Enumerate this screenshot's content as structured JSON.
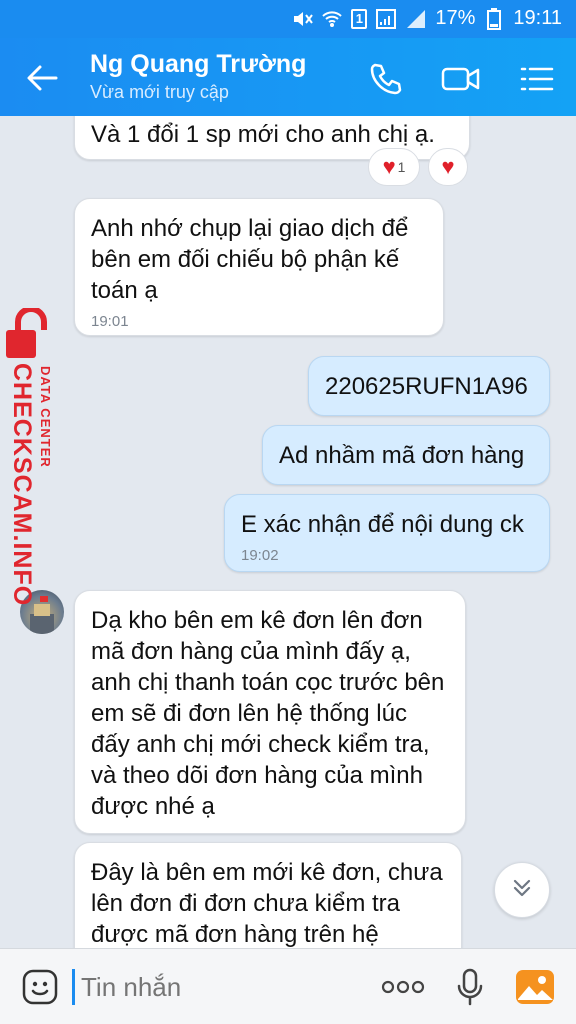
{
  "status_bar": {
    "sim": "1",
    "battery": "17%",
    "time": "19:11"
  },
  "header": {
    "title": "Ng Quang Trường",
    "subtitle": "Vừa mới truy cập",
    "icons": [
      "back-arrow-icon",
      "phone-icon",
      "video-call-icon",
      "menu-list-icon"
    ]
  },
  "messages": [
    {
      "side": "in",
      "text": "Và 1 đổi 1 sp mới cho anh chị ạ."
    },
    {
      "side": "in",
      "text": "Anh nhớ chụp lại giao dịch để bên em đối chiếu bộ phận kế toán ạ",
      "time": "19:01"
    },
    {
      "side": "out",
      "text": "220625RUFN1A96"
    },
    {
      "side": "out",
      "text": "Ad nhầm mã đơn hàng"
    },
    {
      "side": "out",
      "text": "E xác nhận để nội dung ck",
      "time": "19:02"
    },
    {
      "side": "in",
      "text": "Dạ kho bên em kê đơn lên đơn mã đơn hàng của mình đấy ạ, anh chị thanh toán cọc trước bên em sẽ đi đơn lên hệ thống lúc đấy anh chị mới check kiểm tra, và theo dõi đơn hàng của mình được nhé ạ"
    },
    {
      "side": "in",
      "text": "Đây là bên em mới kê đơn, chưa lên đơn đi đơn chưa kiểm tra được mã đơn hàng trên hệ"
    }
  ],
  "reactions": {
    "heart_count": "1"
  },
  "watermark": {
    "main": "CHECKSCAM.INFO",
    "sub": "DATA CENTER"
  },
  "input": {
    "placeholder": "Tin nhắn"
  },
  "colors": {
    "header": "#1a8cf0",
    "outgoing_bubble": "#d6ecff",
    "incoming_bubble": "#ffffff",
    "watermark": "#e0262e"
  }
}
